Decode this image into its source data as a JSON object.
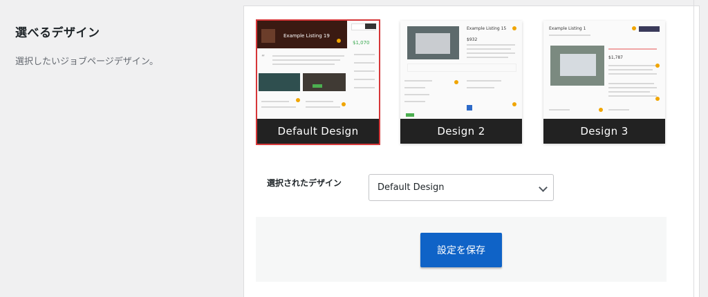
{
  "left": {
    "title": "選べるデザイン",
    "description": "選択したいジョブページデザイン。"
  },
  "designs": [
    {
      "label": "Default Design",
      "selected": true,
      "preview_title": "Example Listing 19",
      "price": "$1,070"
    },
    {
      "label": "Design 2",
      "selected": false,
      "preview_title": "Example Listing 15",
      "price": "$932"
    },
    {
      "label": "Design 3",
      "selected": false,
      "preview_title": "Example Listing 1",
      "price": "$1,787"
    }
  ],
  "selected_design": {
    "label": "選択されたデザイン",
    "value": "Default Design"
  },
  "save_button": "設定を保存",
  "colors": {
    "accent": "#0f63c7",
    "selected_border": "#d63638",
    "label_bg": "#222222",
    "badge": "#f0a500"
  }
}
